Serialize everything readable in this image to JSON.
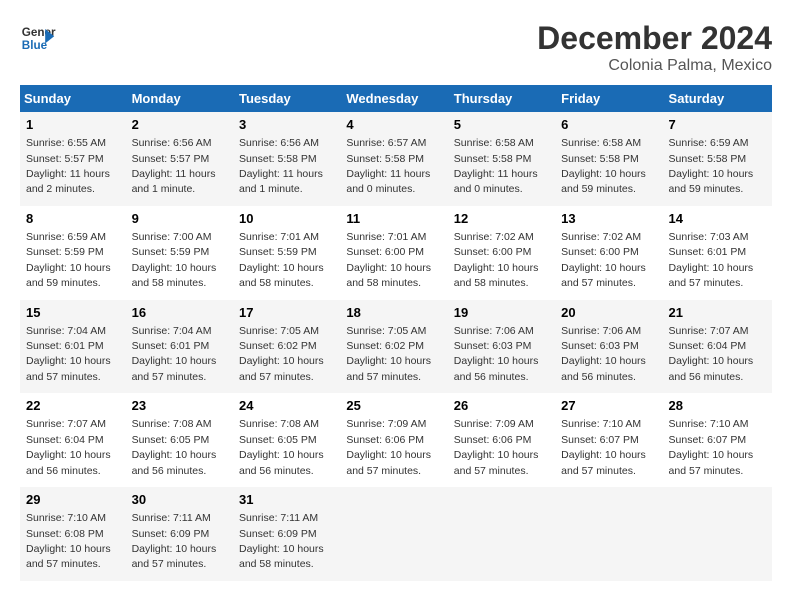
{
  "header": {
    "logo_line1": "General",
    "logo_line2": "Blue",
    "title": "December 2024",
    "subtitle": "Colonia Palma, Mexico"
  },
  "columns": [
    "Sunday",
    "Monday",
    "Tuesday",
    "Wednesday",
    "Thursday",
    "Friday",
    "Saturday"
  ],
  "weeks": [
    [
      {
        "day": "1",
        "info": "Sunrise: 6:55 AM\nSunset: 5:57 PM\nDaylight: 11 hours and 2 minutes."
      },
      {
        "day": "2",
        "info": "Sunrise: 6:56 AM\nSunset: 5:57 PM\nDaylight: 11 hours and 1 minute."
      },
      {
        "day": "3",
        "info": "Sunrise: 6:56 AM\nSunset: 5:58 PM\nDaylight: 11 hours and 1 minute."
      },
      {
        "day": "4",
        "info": "Sunrise: 6:57 AM\nSunset: 5:58 PM\nDaylight: 11 hours and 0 minutes."
      },
      {
        "day": "5",
        "info": "Sunrise: 6:58 AM\nSunset: 5:58 PM\nDaylight: 11 hours and 0 minutes."
      },
      {
        "day": "6",
        "info": "Sunrise: 6:58 AM\nSunset: 5:58 PM\nDaylight: 10 hours and 59 minutes."
      },
      {
        "day": "7",
        "info": "Sunrise: 6:59 AM\nSunset: 5:58 PM\nDaylight: 10 hours and 59 minutes."
      }
    ],
    [
      {
        "day": "8",
        "info": "Sunrise: 6:59 AM\nSunset: 5:59 PM\nDaylight: 10 hours and 59 minutes."
      },
      {
        "day": "9",
        "info": "Sunrise: 7:00 AM\nSunset: 5:59 PM\nDaylight: 10 hours and 58 minutes."
      },
      {
        "day": "10",
        "info": "Sunrise: 7:01 AM\nSunset: 5:59 PM\nDaylight: 10 hours and 58 minutes."
      },
      {
        "day": "11",
        "info": "Sunrise: 7:01 AM\nSunset: 6:00 PM\nDaylight: 10 hours and 58 minutes."
      },
      {
        "day": "12",
        "info": "Sunrise: 7:02 AM\nSunset: 6:00 PM\nDaylight: 10 hours and 58 minutes."
      },
      {
        "day": "13",
        "info": "Sunrise: 7:02 AM\nSunset: 6:00 PM\nDaylight: 10 hours and 57 minutes."
      },
      {
        "day": "14",
        "info": "Sunrise: 7:03 AM\nSunset: 6:01 PM\nDaylight: 10 hours and 57 minutes."
      }
    ],
    [
      {
        "day": "15",
        "info": "Sunrise: 7:04 AM\nSunset: 6:01 PM\nDaylight: 10 hours and 57 minutes."
      },
      {
        "day": "16",
        "info": "Sunrise: 7:04 AM\nSunset: 6:01 PM\nDaylight: 10 hours and 57 minutes."
      },
      {
        "day": "17",
        "info": "Sunrise: 7:05 AM\nSunset: 6:02 PM\nDaylight: 10 hours and 57 minutes."
      },
      {
        "day": "18",
        "info": "Sunrise: 7:05 AM\nSunset: 6:02 PM\nDaylight: 10 hours and 57 minutes."
      },
      {
        "day": "19",
        "info": "Sunrise: 7:06 AM\nSunset: 6:03 PM\nDaylight: 10 hours and 56 minutes."
      },
      {
        "day": "20",
        "info": "Sunrise: 7:06 AM\nSunset: 6:03 PM\nDaylight: 10 hours and 56 minutes."
      },
      {
        "day": "21",
        "info": "Sunrise: 7:07 AM\nSunset: 6:04 PM\nDaylight: 10 hours and 56 minutes."
      }
    ],
    [
      {
        "day": "22",
        "info": "Sunrise: 7:07 AM\nSunset: 6:04 PM\nDaylight: 10 hours and 56 minutes."
      },
      {
        "day": "23",
        "info": "Sunrise: 7:08 AM\nSunset: 6:05 PM\nDaylight: 10 hours and 56 minutes."
      },
      {
        "day": "24",
        "info": "Sunrise: 7:08 AM\nSunset: 6:05 PM\nDaylight: 10 hours and 56 minutes."
      },
      {
        "day": "25",
        "info": "Sunrise: 7:09 AM\nSunset: 6:06 PM\nDaylight: 10 hours and 57 minutes."
      },
      {
        "day": "26",
        "info": "Sunrise: 7:09 AM\nSunset: 6:06 PM\nDaylight: 10 hours and 57 minutes."
      },
      {
        "day": "27",
        "info": "Sunrise: 7:10 AM\nSunset: 6:07 PM\nDaylight: 10 hours and 57 minutes."
      },
      {
        "day": "28",
        "info": "Sunrise: 7:10 AM\nSunset: 6:07 PM\nDaylight: 10 hours and 57 minutes."
      }
    ],
    [
      {
        "day": "29",
        "info": "Sunrise: 7:10 AM\nSunset: 6:08 PM\nDaylight: 10 hours and 57 minutes."
      },
      {
        "day": "30",
        "info": "Sunrise: 7:11 AM\nSunset: 6:09 PM\nDaylight: 10 hours and 57 minutes."
      },
      {
        "day": "31",
        "info": "Sunrise: 7:11 AM\nSunset: 6:09 PM\nDaylight: 10 hours and 58 minutes."
      },
      null,
      null,
      null,
      null
    ]
  ]
}
